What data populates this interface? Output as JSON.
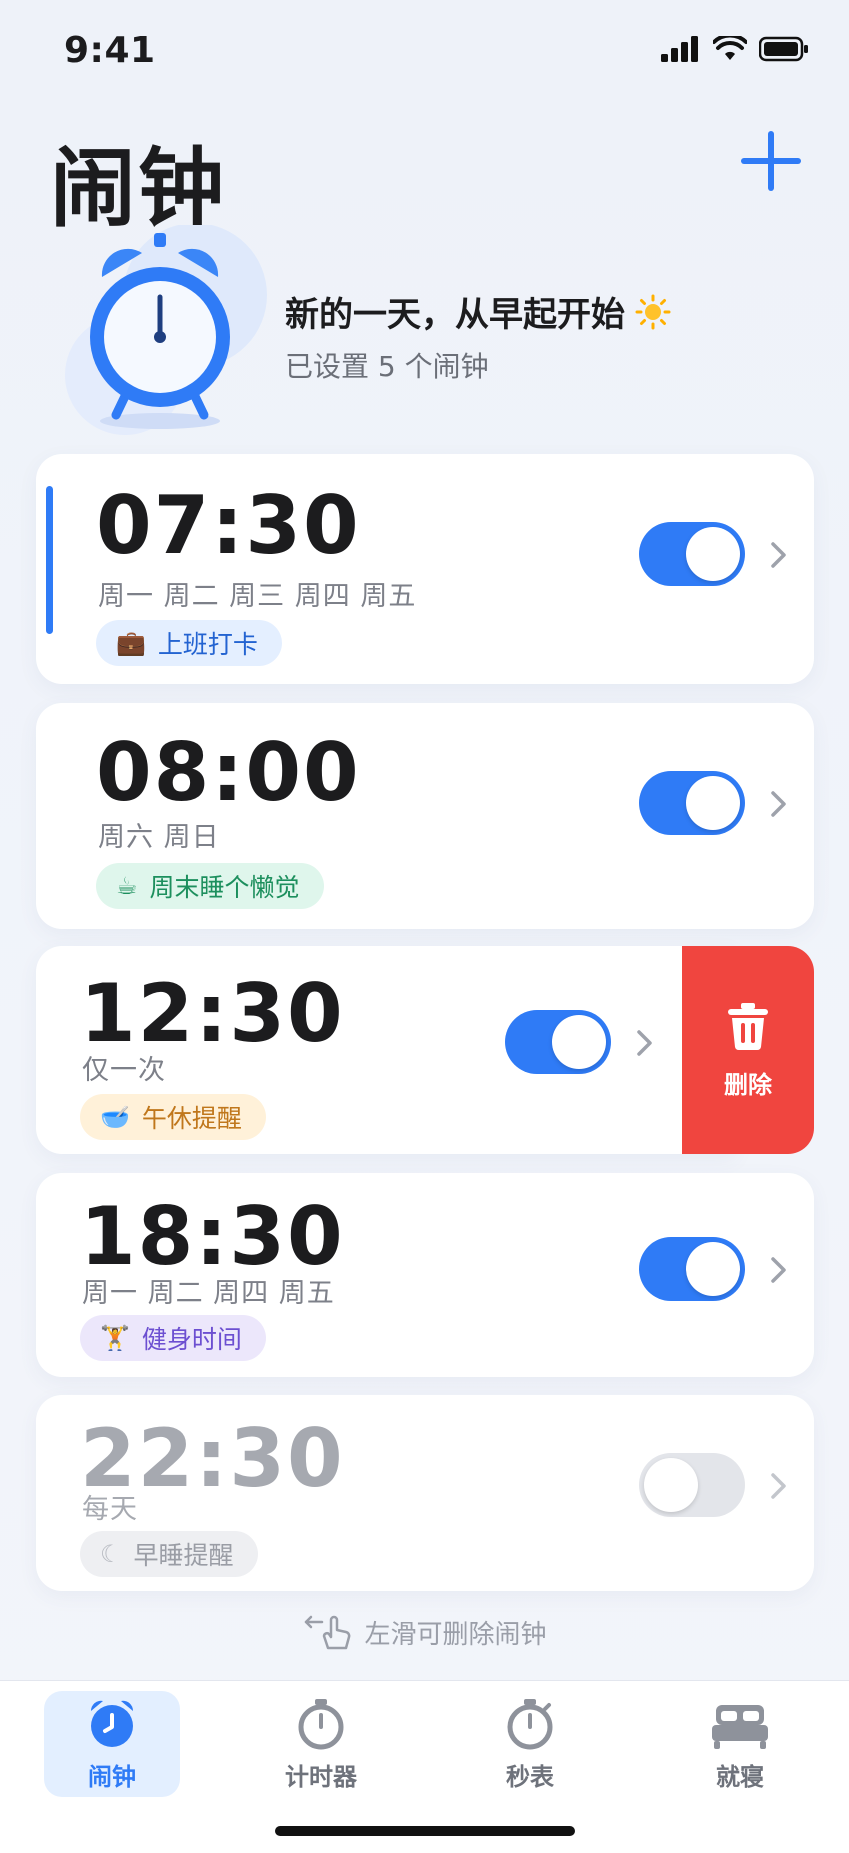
{
  "status_bar": {
    "time": "9:41"
  },
  "header": {
    "title": "闹钟"
  },
  "hero": {
    "title": "新的一天，从早起开始",
    "subtitle": "已设置 5 个闹钟"
  },
  "alarms": [
    {
      "time": "07:30",
      "days": "周一 周二 周三 周四 周五",
      "label": "上班打卡",
      "label_icon": "briefcase-icon",
      "enabled": true
    },
    {
      "time": "08:00",
      "days": "周六 周日",
      "label": "周末睡个懒觉",
      "label_icon": "coffee-icon",
      "enabled": true
    },
    {
      "time": "12:30",
      "days": "仅一次",
      "label": "午休提醒",
      "label_icon": "bowl-icon",
      "enabled": true
    },
    {
      "time": "18:30",
      "days": "周一 周二 周四 周五",
      "label": "健身时间",
      "label_icon": "dumbbell-icon",
      "enabled": true
    },
    {
      "time": "22:30",
      "days": "每天",
      "label": "早睡提醒",
      "label_icon": "moon-icon",
      "enabled": false
    }
  ],
  "swipe_action": {
    "label": "删除",
    "icon": "trash-icon",
    "color": "#f0453f"
  },
  "hint": {
    "text": "左滑可删除闹钟"
  },
  "tabs": [
    {
      "label": "闹钟",
      "icon": "alarm-clock-icon",
      "active": true
    },
    {
      "label": "计时器",
      "icon": "timer-icon",
      "active": false
    },
    {
      "label": "秒表",
      "icon": "stopwatch-icon",
      "active": false
    },
    {
      "label": "就寝",
      "icon": "bed-icon",
      "active": false
    }
  ],
  "colors": {
    "accent": "#2f7bf6",
    "danger": "#f0453f",
    "background": "#eef2f9"
  }
}
